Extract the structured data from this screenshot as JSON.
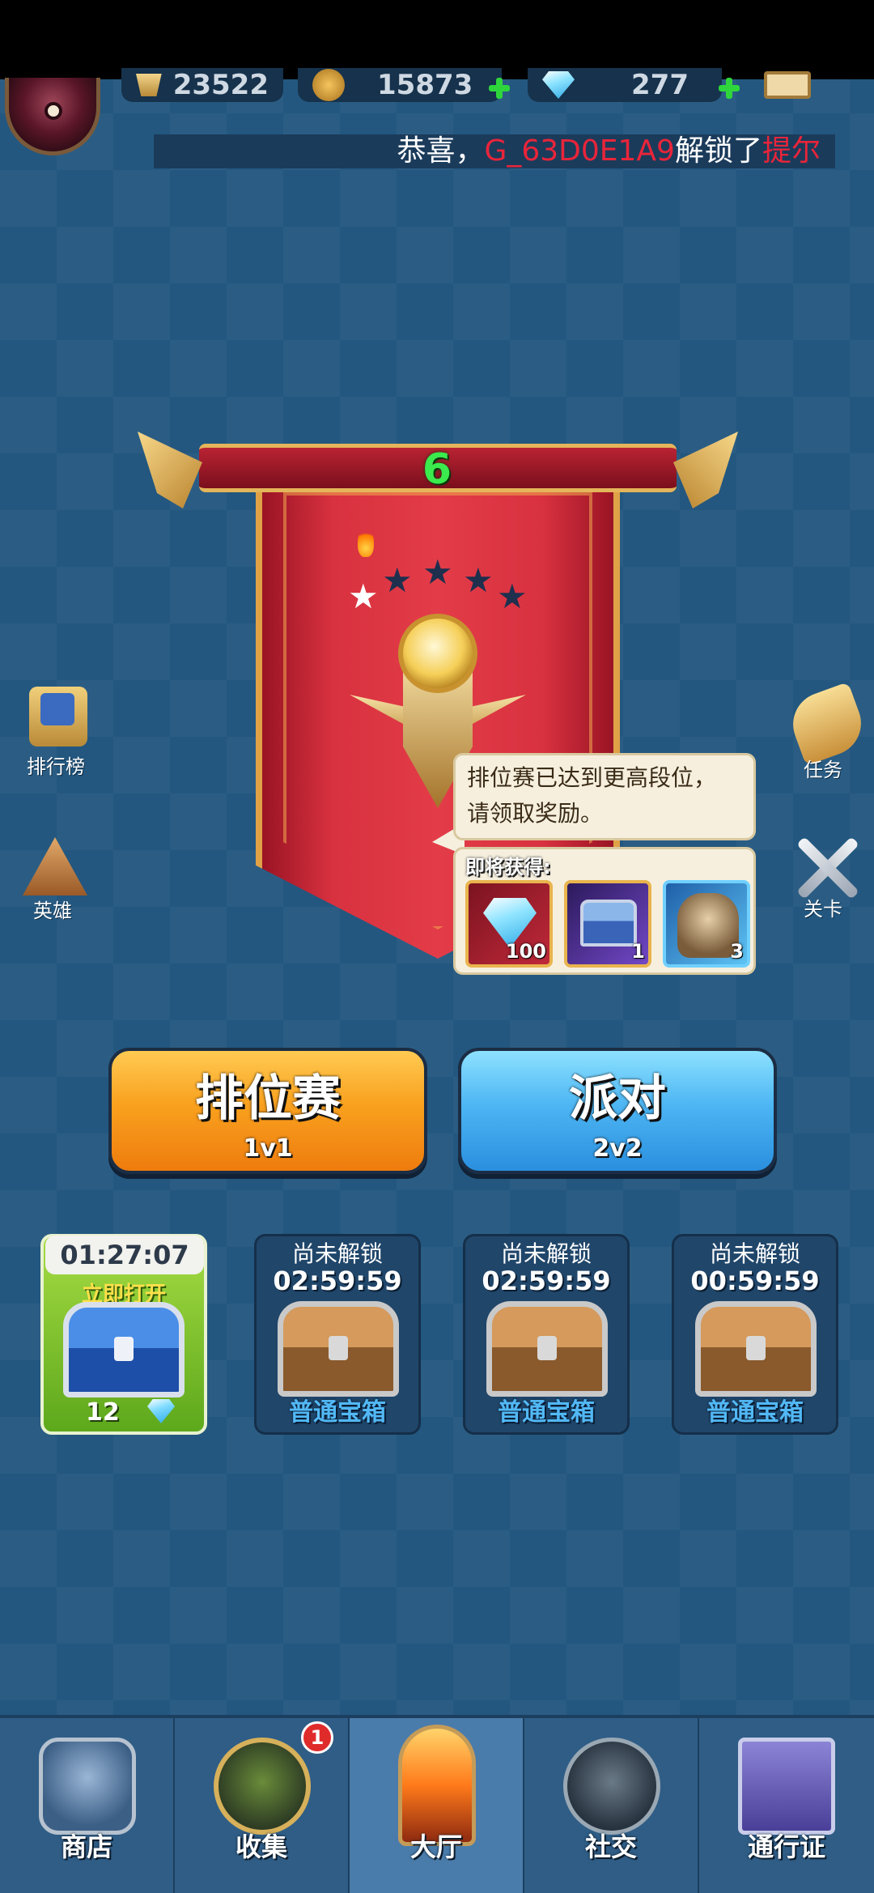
{
  "resources": {
    "trophies": "23522",
    "gold": "15873",
    "diamonds": "277"
  },
  "ticker": {
    "prefix": "恭喜，",
    "player": "G_63D0E1A9",
    "middle": "解锁了",
    "item": "提尔"
  },
  "banner": {
    "rank": "6",
    "stars_total": 5,
    "stars_filled": 1
  },
  "tooltip": {
    "line1": "排位赛已达到更高段位，",
    "line2": "请领取奖励。",
    "rewards_label": "即将获得:",
    "rewards": [
      {
        "icon": "diamond-icon",
        "count": "100"
      },
      {
        "icon": "chest-icon",
        "count": "1"
      },
      {
        "icon": "hero-card-icon",
        "count": "3"
      }
    ]
  },
  "side": {
    "leaderboard": "排行榜",
    "heroes": "英雄",
    "quests": "任务",
    "stages": "关卡"
  },
  "modes": {
    "ranked": {
      "title": "排位赛",
      "sub": "1v1"
    },
    "party": {
      "title": "派对",
      "sub": "2v2"
    }
  },
  "chests": {
    "slot1": {
      "timer": "01:27:07",
      "action": "立即打开",
      "cost": "12"
    },
    "slot2": {
      "status": "尚未解锁",
      "time": "02:59:59",
      "label": "普通宝箱"
    },
    "slot3": {
      "status": "尚未解锁",
      "time": "02:59:59",
      "label": "普通宝箱"
    },
    "slot4": {
      "status": "尚未解锁",
      "time": "00:59:59",
      "label": "普通宝箱"
    }
  },
  "nav": {
    "shop": "商店",
    "collect": "收集",
    "collect_badge": "1",
    "hall": "大厅",
    "social": "社交",
    "pass": "通行证"
  },
  "colors": {
    "background": "#23577f",
    "ticker_highlight": "#e8253a",
    "rank_green": "#3bea4d",
    "ranked_orange": "#f9a11e",
    "party_blue": "#4db6f3"
  }
}
